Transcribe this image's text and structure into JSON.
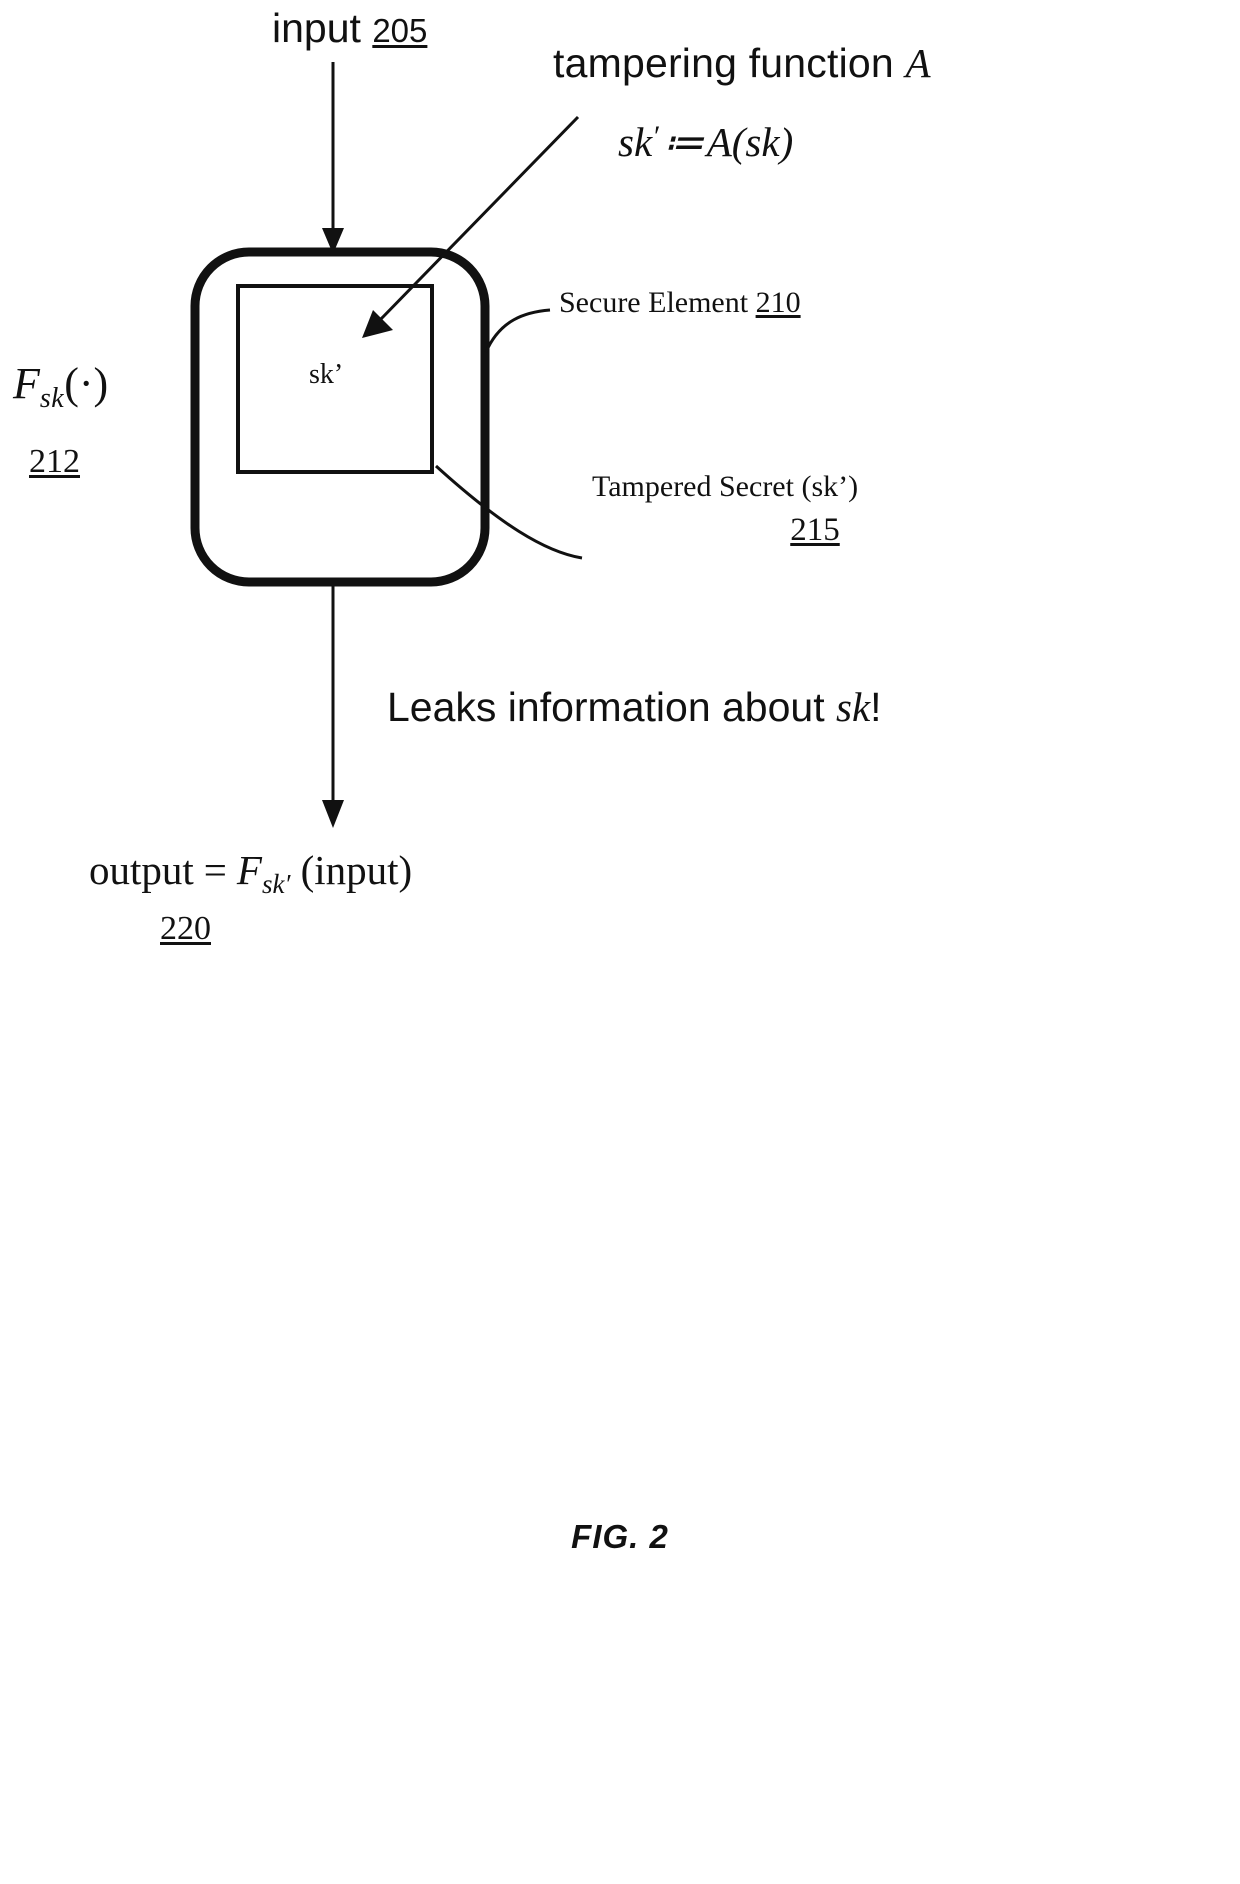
{
  "figure": {
    "caption": "FIG. 2",
    "input": {
      "text": "input",
      "ref": "205"
    },
    "tampering": {
      "title_prefix": "tampering function ",
      "title_symbol": "A",
      "formula_lhs": "sk",
      "formula_prime": "′",
      "formula_assign": "≔",
      "formula_rhs": "A(sk)"
    },
    "secure_element": {
      "label": "Secure Element",
      "ref": "210"
    },
    "inner_box": {
      "secret": "sk’"
    },
    "function_label": {
      "symbol": "F",
      "subscript": "sk",
      "argument": "(·)",
      "ref": "212"
    },
    "tampered_secret": {
      "label": "Tampered Secret (sk’)",
      "ref": "215"
    },
    "leaks": {
      "prefix": "Leaks information about ",
      "symbol": "sk",
      "suffix": "!"
    },
    "output": {
      "word": "output",
      "equals": "=",
      "symbol": "F",
      "subscript": "sk′",
      "argument": "(input)",
      "ref": "220"
    }
  },
  "colors": {
    "ink": "#111111",
    "background": "#ffffff"
  }
}
